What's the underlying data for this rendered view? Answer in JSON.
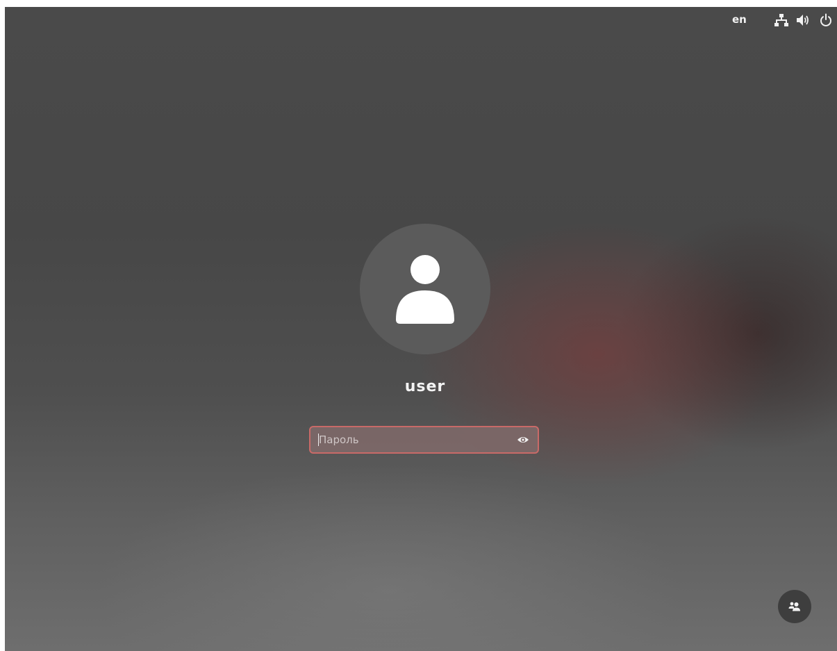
{
  "topbar": {
    "keyboard_layout": "en",
    "icons": [
      "network-wired-icon",
      "volume-icon",
      "power-icon"
    ]
  },
  "login": {
    "avatar_icon": "user-avatar-icon",
    "username": "user",
    "password_placeholder": "Пароль",
    "password_value": "",
    "reveal_icon": "eye-icon"
  },
  "bottom": {
    "switch_user_icon": "users-icon"
  },
  "colors": {
    "field_border": "#c96a68",
    "field_background": "#7d6868",
    "text": "#f4f4f4"
  }
}
